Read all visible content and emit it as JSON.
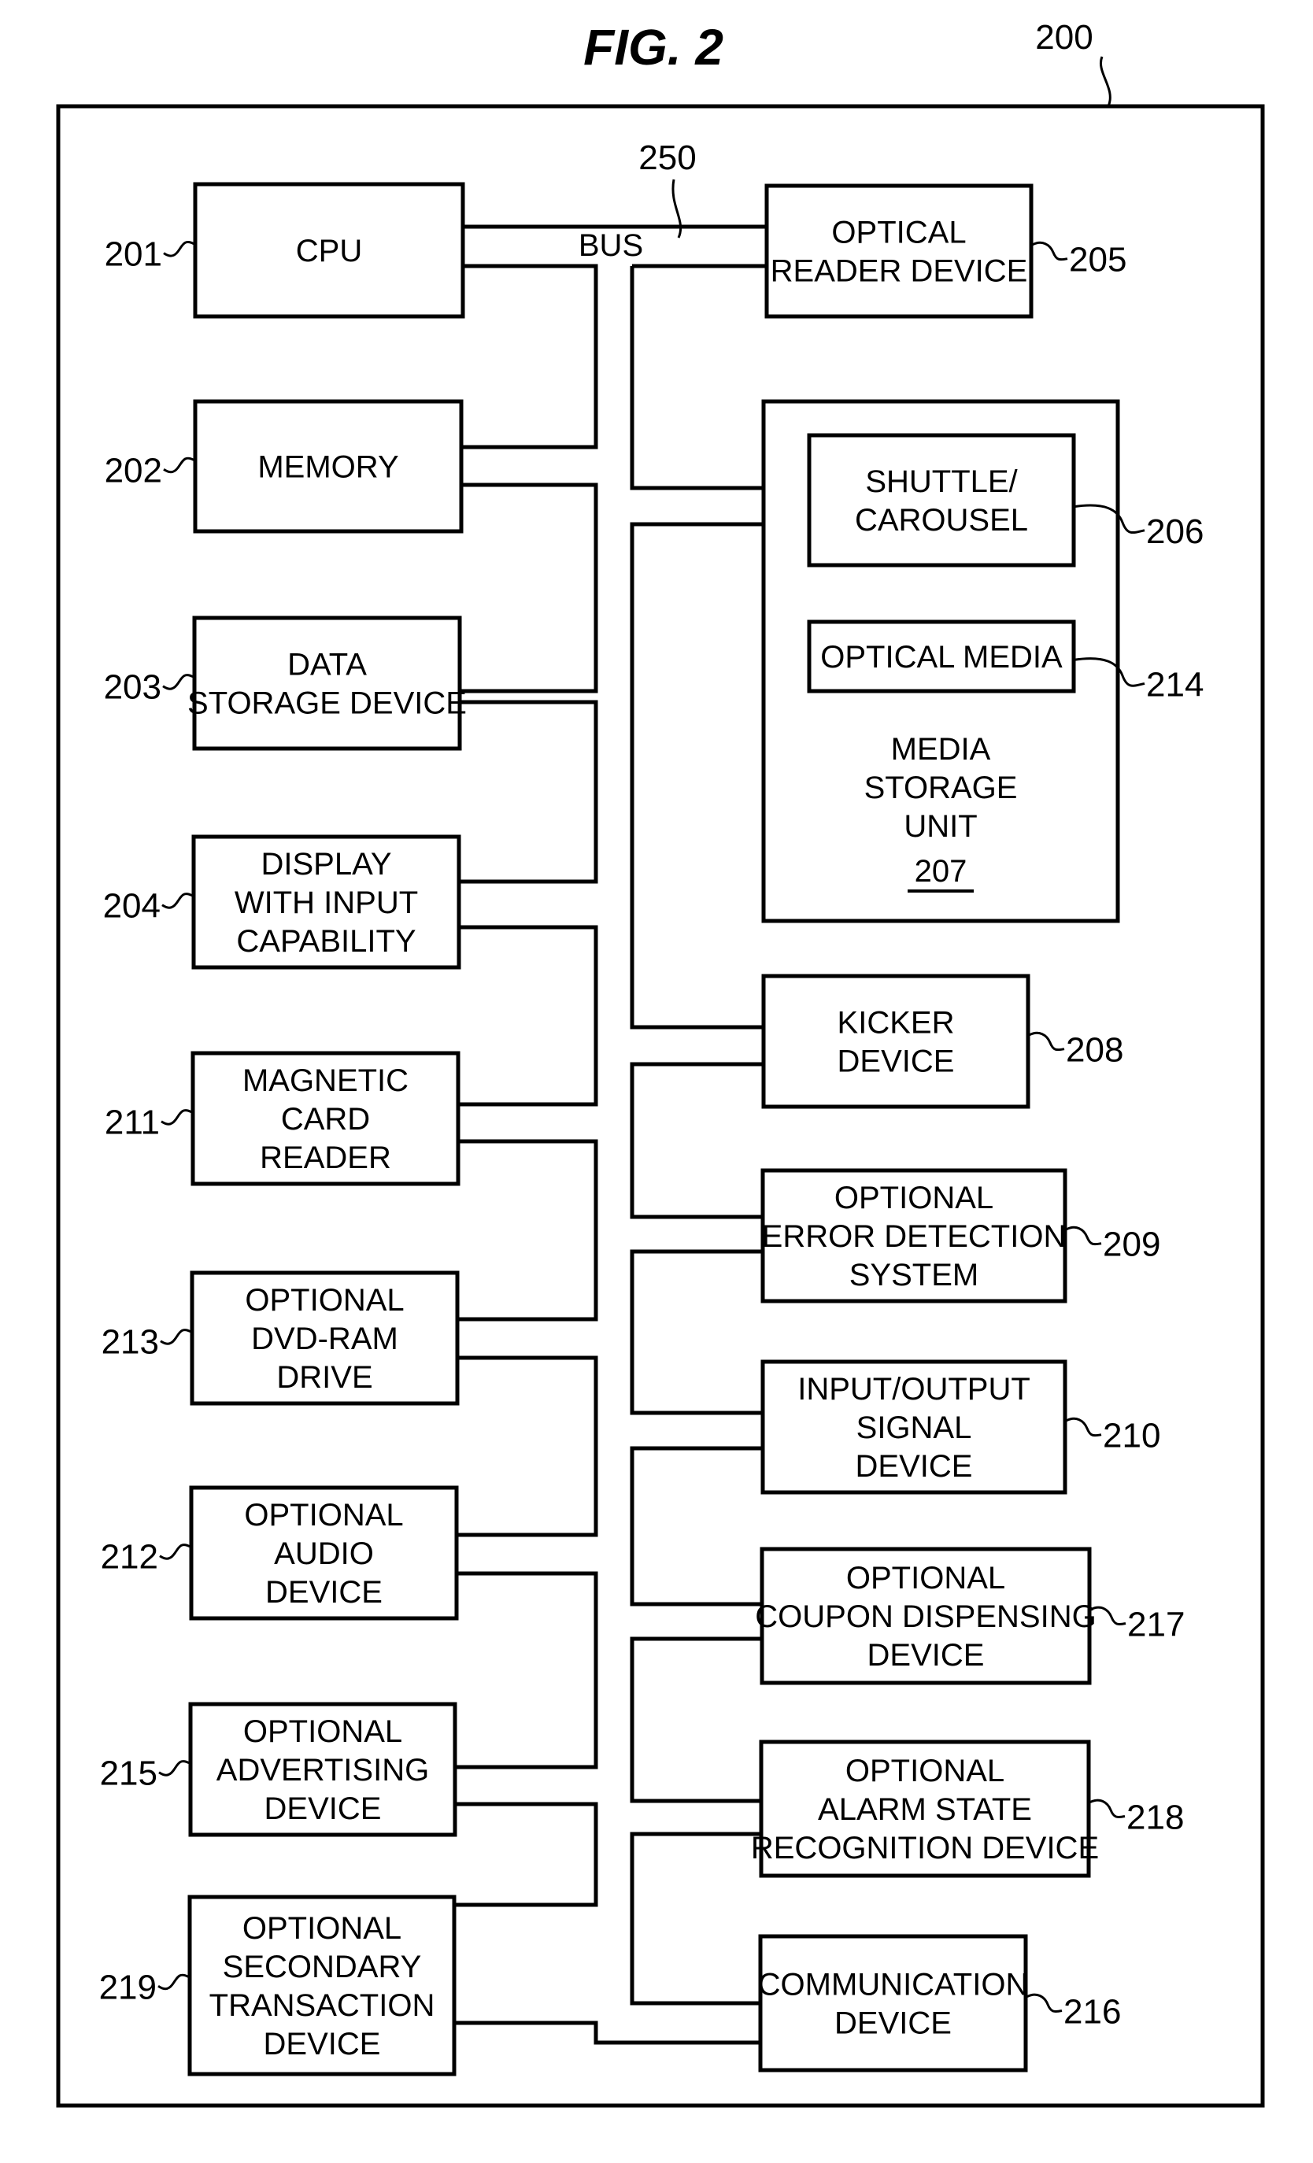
{
  "figure": {
    "title": "FIG. 2",
    "system_ref": "200",
    "bus": {
      "label": "BUS",
      "ref": "250"
    }
  },
  "left_components": [
    {
      "ref": "201",
      "lines": [
        "CPU"
      ]
    },
    {
      "ref": "202",
      "lines": [
        "MEMORY"
      ]
    },
    {
      "ref": "203",
      "lines": [
        "DATA",
        "STORAGE DEVICE"
      ]
    },
    {
      "ref": "204",
      "lines": [
        "DISPLAY",
        "WITH INPUT",
        "CAPABILITY"
      ]
    },
    {
      "ref": "211",
      "lines": [
        "MAGNETIC",
        "CARD",
        "READER"
      ]
    },
    {
      "ref": "213",
      "lines": [
        "OPTIONAL",
        "DVD-RAM",
        "DRIVE"
      ]
    },
    {
      "ref": "212",
      "lines": [
        "OPTIONAL",
        "AUDIO",
        "DEVICE"
      ]
    },
    {
      "ref": "215",
      "lines": [
        "OPTIONAL",
        "ADVERTISING",
        "DEVICE"
      ]
    },
    {
      "ref": "219",
      "lines": [
        "OPTIONAL",
        "SECONDARY",
        "TRANSACTION",
        "DEVICE"
      ]
    }
  ],
  "right_components": [
    {
      "ref": "205",
      "lines": [
        "OPTICAL",
        "READER DEVICE"
      ]
    },
    {
      "ref": "207",
      "lines": [
        "MEDIA",
        "STORAGE",
        "UNIT"
      ],
      "children": [
        {
          "ref": "206",
          "lines": [
            "SHUTTLE/",
            "CAROUSEL"
          ]
        },
        {
          "ref": "214",
          "lines": [
            "OPTICAL MEDIA"
          ]
        }
      ]
    },
    {
      "ref": "208",
      "lines": [
        "KICKER",
        "DEVICE"
      ]
    },
    {
      "ref": "209",
      "lines": [
        "OPTIONAL",
        "ERROR DETECTION",
        "SYSTEM"
      ]
    },
    {
      "ref": "210",
      "lines": [
        "INPUT/OUTPUT",
        "SIGNAL",
        "DEVICE"
      ]
    },
    {
      "ref": "217",
      "lines": [
        "OPTIONAL",
        "COUPON DISPENSING",
        "DEVICE"
      ]
    },
    {
      "ref": "218",
      "lines": [
        "OPTIONAL",
        "ALARM STATE",
        "RECOGNITION DEVICE"
      ]
    },
    {
      "ref": "216",
      "lines": [
        "COMMUNICATION",
        "DEVICE"
      ]
    }
  ]
}
